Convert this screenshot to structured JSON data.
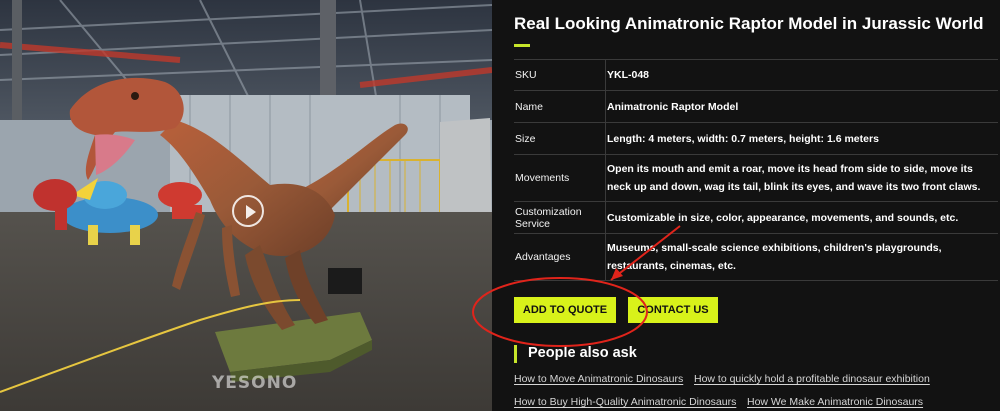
{
  "product": {
    "title": "Real Looking Animatronic Raptor Model in Jurassic World",
    "specs": [
      {
        "key": "SKU",
        "value": "YKL-048"
      },
      {
        "key": "Name",
        "value": "Animatronic Raptor Model"
      },
      {
        "key": "Size",
        "value": "Length: 4 meters, width: 0.7 meters, height: 1.6 meters"
      },
      {
        "key": "Movements",
        "value": "Open its mouth and emit a roar, move its head from side to side, move its neck up and down, wag its tail, blink its eyes, and wave its two front claws."
      },
      {
        "key": "Customization Service",
        "value": "Customizable in size, color, appearance, movements, and sounds, etc."
      },
      {
        "key": "Advantages",
        "value": "Museums, small-scale science exhibitions, children's playgrounds, restaurants, cinemas, etc."
      }
    ]
  },
  "buttons": {
    "add_to_quote": "ADD TO QUOTE",
    "contact_us": "CONTACT US"
  },
  "media": {
    "watermark": "YESONO",
    "play_icon": "play-icon"
  },
  "people_also_ask": {
    "title": "People also ask",
    "links": [
      "How to Move Animatronic Dinosaurs",
      "How to quickly hold a profitable dinosaur exhibition",
      "How to Buy High-Quality Animatronic Dinosaurs",
      "How We Make Animatronic Dinosaurs"
    ]
  },
  "colors": {
    "accent": "#d8f21a",
    "annotation": "#e0241b",
    "background": "#121212"
  }
}
